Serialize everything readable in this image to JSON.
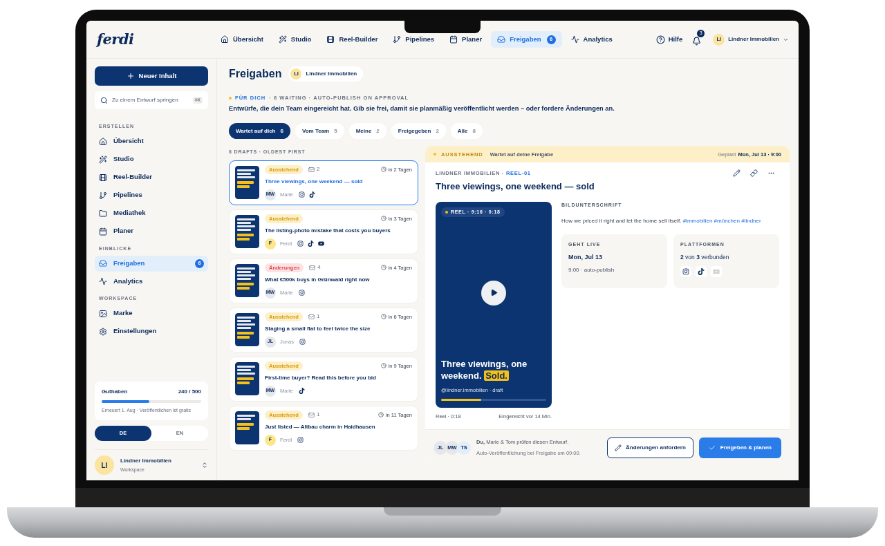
{
  "logo": "ferdi",
  "topnav": [
    {
      "label": "Übersicht",
      "selected": false
    },
    {
      "label": "Studio",
      "selected": false
    },
    {
      "label": "Reel-Builder",
      "selected": false
    },
    {
      "label": "Pipelines",
      "selected": false
    },
    {
      "label": "Planer",
      "selected": false
    },
    {
      "label": "Freigaben",
      "selected": true,
      "badge": "6"
    },
    {
      "label": "Analytics",
      "selected": false
    }
  ],
  "header_right": {
    "help": "Hilfe",
    "notifications": "3",
    "account": {
      "initials": "LI",
      "name": "Lindner Immobilien"
    }
  },
  "sidebar": {
    "new_button": "Neuer Inhalt",
    "search": {
      "placeholder": "Zu einem Entwurf springen",
      "shortcut": "⌘K"
    },
    "sections": [
      {
        "title": "ERSTELLEN",
        "items": [
          {
            "label": "Übersicht",
            "selected": false
          },
          {
            "label": "Studio",
            "selected": false
          },
          {
            "label": "Reel-Builder",
            "selected": false
          },
          {
            "label": "Pipelines",
            "selected": false
          },
          {
            "label": "Mediathek",
            "selected": false
          },
          {
            "label": "Planer",
            "selected": false
          }
        ]
      },
      {
        "title": "EINBLICKE",
        "items": [
          {
            "label": "Freigaben",
            "selected": true,
            "badge": "6"
          },
          {
            "label": "Analytics",
            "selected": false
          }
        ]
      },
      {
        "title": "WORKSPACE",
        "items": [
          {
            "label": "Marke",
            "selected": false
          },
          {
            "label": "Einstellungen",
            "selected": false
          }
        ]
      }
    ],
    "credits": {
      "label": "Guthaben",
      "value": "240 / 500",
      "level": 0.48,
      "note": "Erneuert 1. Aug · Veröffentlichen ist gratis"
    },
    "languages": [
      {
        "label": "DE",
        "selected": true
      },
      {
        "label": "EN",
        "selected": false
      }
    ],
    "workspace": {
      "initials": "LI",
      "name": "Lindner Immobilien",
      "subtitle": "Workspace"
    }
  },
  "page": {
    "title": "Freigaben",
    "client_chip": {
      "initials": "LI",
      "name": "Lindner Immobilien"
    },
    "eyebrow": {
      "highlight": "FÜR DICH",
      "rest": "· 6 WAITING · AUTO-PUBLISH ON APPROVAL"
    },
    "description": "Entwürfe, die dein Team eingereicht hat. Gib sie frei, damit sie planmäßig veröffentlicht werden – oder fordere Änderungen an.",
    "filters": [
      {
        "label": "Wartet auf dich",
        "count": "6",
        "selected": true
      },
      {
        "label": "Vom Team",
        "count": "5",
        "selected": false
      },
      {
        "label": "Meine",
        "count": "2",
        "selected": false
      },
      {
        "label": "Freigegeben",
        "count": "2",
        "selected": false
      },
      {
        "label": "Alle",
        "count": "8",
        "selected": false
      }
    ],
    "list_label": "6 DRAFTS · OLDEST FIRST",
    "drafts": [
      {
        "selected": true,
        "status": {
          "kind": "pending",
          "label": "Ausstehend"
        },
        "comments": "2",
        "due": "in 2 Tagen",
        "title": "Three viewings, one weekend — sold",
        "author": {
          "initials": "MW",
          "name": "Marie",
          "color": "#e5e7eb"
        },
        "platforms": [
          {
            "kind": "instagram"
          },
          {
            "kind": "tiktok"
          }
        ]
      },
      {
        "selected": false,
        "status": {
          "kind": "pending",
          "label": "Ausstehend"
        },
        "due": "in 3 Tagen",
        "title": "The listing-photo mistake that costs you buyers",
        "author": {
          "initials": "F",
          "name": "Ferdi",
          "color": "#fde68a"
        },
        "platforms": [
          {
            "kind": "instagram"
          },
          {
            "kind": "tiktok"
          },
          {
            "kind": "youtube"
          }
        ]
      },
      {
        "selected": false,
        "status": {
          "kind": "changes",
          "label": "Änderungen"
        },
        "comments": "4",
        "due": "in 4 Tagen",
        "title": "What €500k buys in Grünwald right now",
        "author": {
          "initials": "MW",
          "name": "Marie",
          "color": "#e5e7eb"
        },
        "platforms": [
          {
            "kind": "instagram"
          }
        ]
      },
      {
        "selected": false,
        "status": {
          "kind": "pending",
          "label": "Ausstehend"
        },
        "comments": "1",
        "due": "in 6 Tagen",
        "title": "Staging a small flat to feel twice the size",
        "author": {
          "initials": "JL",
          "name": "Jonas",
          "color": "#e5e7eb"
        },
        "platforms": [
          {
            "kind": "instagram"
          }
        ]
      },
      {
        "selected": false,
        "status": {
          "kind": "pending",
          "label": "Ausstehend"
        },
        "due": "in 9 Tagen",
        "title": "First-time buyer? Read this before you bid",
        "author": {
          "initials": "MW",
          "name": "Marie",
          "color": "#e5e7eb"
        },
        "platforms": [
          {
            "kind": "tiktok"
          }
        ]
      },
      {
        "selected": false,
        "status": {
          "kind": "pending",
          "label": "Ausstehend"
        },
        "comments": "1",
        "due": "in 11 Tagen",
        "title": "Just listed — Altbau charm in Haidhausen",
        "author": {
          "initials": "F",
          "name": "Ferdi",
          "color": "#fde68a"
        },
        "platforms": [
          {
            "kind": "instagram"
          }
        ]
      }
    ],
    "detail": {
      "banner": {
        "status": "AUSSTEHEND",
        "message": "Wartet auf deine Freigabe",
        "scheduled_label": "Geplant",
        "scheduled": "Mon, Jul 13 · 9:00"
      },
      "meta": {
        "client": "LINDNER IMMOBILIEN ·",
        "id": "REEL-01"
      },
      "title": "Three viewings, one weekend — sold",
      "video": {
        "badge": "REEL · 9:16 · 0:18",
        "headline": "Three viewings, one weekend.",
        "highlight": "Sold.",
        "handle": "@lindner.immobilien · draft",
        "level": 0.38
      },
      "video_meta": {
        "left": "Reel · 0:18",
        "right": "Eingereicht vor 14 Min."
      },
      "caption": {
        "label": "BILDUNTERSCHRIFT",
        "text": "How we priced it right and let the home sell itself.",
        "hashtags": [
          "#immobilien",
          "#münchen",
          "#lindner"
        ]
      },
      "golive": {
        "label": "GEHT LIVE",
        "date": "Mon, Jul 13",
        "time": "9:00 · auto-publish"
      },
      "platforms": {
        "label": "PLATTFORMEN",
        "summary": "**2** von **3** verbunden",
        "items": [
          {
            "kind": "instagram",
            "connected": true
          },
          {
            "kind": "tiktok",
            "connected": true
          },
          {
            "kind": "youtube",
            "connected": false
          }
        ]
      },
      "reviewers": [
        "JL",
        "MW",
        "TS"
      ],
      "review_text": "**Du,** Marie & Tom prüfen diesen Entwurf.",
      "review_note": "Auto-Veröffentlichung bei Freigabe um 09:00.",
      "request_button": "Änderungen anfordern",
      "approve_button": "Freigeben & planen"
    }
  }
}
